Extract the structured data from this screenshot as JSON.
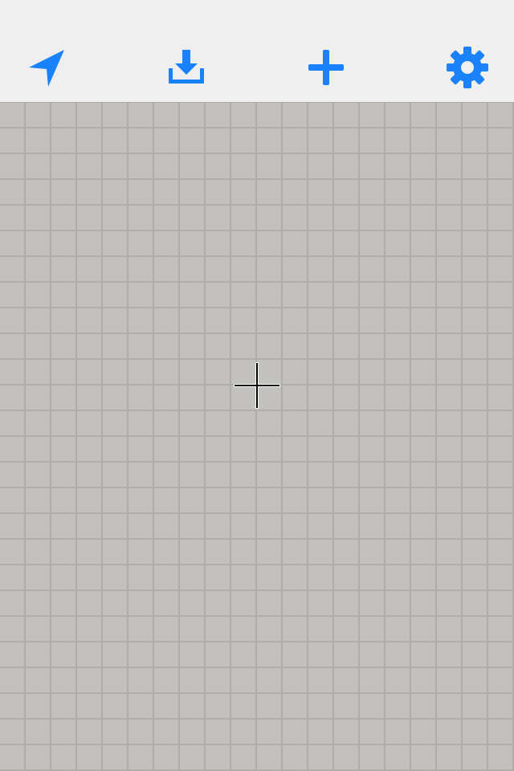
{
  "toolbar": {
    "items": [
      {
        "id": "locate",
        "icon": "location-arrow-icon"
      },
      {
        "id": "download",
        "icon": "download-icon"
      },
      {
        "id": "add",
        "icon": "plus-icon"
      },
      {
        "id": "settings",
        "icon": "gear-icon"
      }
    ]
  },
  "map": {
    "center_marker": "crosshair-icon"
  },
  "colors": {
    "accent": "#1a82fb",
    "toolbar_bg": "#efefef",
    "map_bg": "#c3c1bd",
    "grid_line": "#b0aeaa"
  }
}
